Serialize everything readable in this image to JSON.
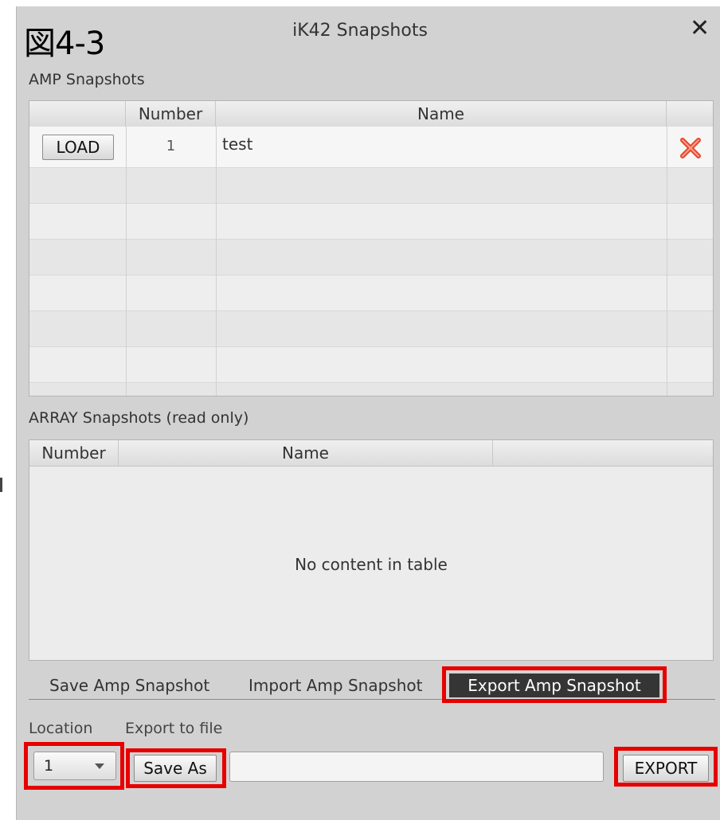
{
  "figure_label": "図4-3",
  "window": {
    "title": "iK42 Snapshots",
    "close_glyph": "✕"
  },
  "amp": {
    "section_label": "AMP Snapshots",
    "columns": [
      "",
      "Number",
      "Name",
      ""
    ],
    "rows": [
      {
        "action": "LOAD",
        "number": "1",
        "name": "test",
        "delete_icon": "delete-x-icon"
      }
    ],
    "delete_color": "#e8462b"
  },
  "array": {
    "section_label": "ARRAY Snapshots (read only)",
    "columns": [
      "Number",
      "Name",
      ""
    ],
    "empty_text": "No content in table"
  },
  "tabs": [
    {
      "label": "Save Amp Snapshot",
      "active": false
    },
    {
      "label": "Import Amp Snapshot",
      "active": false
    },
    {
      "label": "Export Amp Snapshot",
      "active": true
    }
  ],
  "export": {
    "location_label": "Location",
    "file_label": "Export to file",
    "location_value": "1",
    "save_as_label": "Save As",
    "file_value": "",
    "export_label": "EXPORT"
  },
  "highlight_color": "#e60000"
}
